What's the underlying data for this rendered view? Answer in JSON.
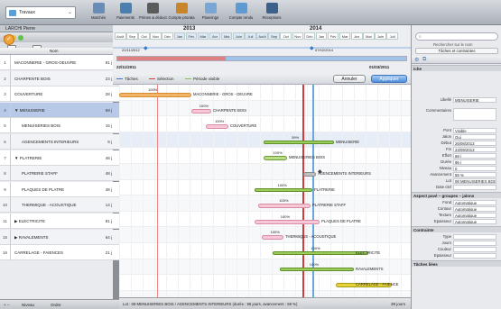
{
  "toolbar": {
    "project": "Travaux",
    "items": [
      {
        "label": "Marchés",
        "icon": "markets-icon",
        "color": "#6a8cb8"
      },
      {
        "label": "Paiements",
        "icon": "payments-icon",
        "color": "#4a7fb0"
      },
      {
        "label": "Primes & déduct.",
        "icon": "bonus-icon",
        "color": "#5b5b5b"
      },
      {
        "label": "Compte prorata",
        "icon": "prorata-icon",
        "color": "#c9852a"
      },
      {
        "label": "Plannings",
        "icon": "planning-icon",
        "color": "#7aa6d6"
      },
      {
        "label": "Compte rendu",
        "icon": "report-icon",
        "color": "#5e9bd5"
      },
      {
        "label": "Réceptions",
        "icon": "reception-icon",
        "color": "#3d5f8c"
      }
    ]
  },
  "user": "LARCHI Pierre",
  "left_tools": {
    "calendar": "Calendrier",
    "display": "Afficher"
  },
  "table": {
    "col_name": "Nom",
    "rows": [
      {
        "num": "1",
        "name": "MACONNERIE - GROS-OEUVRE",
        "dur": "91 j"
      },
      {
        "num": "2",
        "name": "CHARPENTE BOIS",
        "dur": "23 j"
      },
      {
        "num": "3",
        "name": "COUVERTURE",
        "dur": "28 j"
      },
      {
        "num": "4",
        "name": "▼ MENUISERIE",
        "dur": "69 j"
      },
      {
        "num": "5",
        "name": "MENUISERIES BOIS",
        "dur": "15 j"
      },
      {
        "num": "6",
        "name": "AGENCEMENTS INTERIEURS",
        "dur": "9 j"
      },
      {
        "num": "7",
        "name": "▼ PLATRERIE",
        "dur": "48 j"
      },
      {
        "num": "8",
        "name": "PLATRERIE STAFF",
        "dur": "48 j"
      },
      {
        "num": "9",
        "name": "PLAQUES DE PLATRE",
        "dur": "48 j"
      },
      {
        "num": "10",
        "name": "THERMIQUE - ACOUSTIQUE",
        "dur": "14 j"
      },
      {
        "num": "11",
        "name": "▶ ELECTRICITE",
        "dur": "81 j"
      },
      {
        "num": "15",
        "name": "▶ RAVALEMENTS",
        "dur": "64 j"
      },
      {
        "num": "16",
        "name": "CARRELAGE - FAIENCES",
        "dur": "21 j"
      }
    ]
  },
  "left_bottom": {
    "level": "Niveau",
    "order": "Ordre"
  },
  "timeline": {
    "year1": "2013",
    "year2": "2014",
    "months": [
      "Août",
      "Sep",
      "Oct",
      "Nov",
      "Déc",
      "Jan",
      "Fév",
      "Mar",
      "Avr",
      "Mai",
      "Juin",
      "Juil",
      "Août",
      "Sep",
      "Oct",
      "Nov",
      "Déc",
      "Jan",
      "Fév",
      "Mar",
      "Avr",
      "Mai",
      "Juin",
      "Juil"
    ],
    "date1": "22/11/2012",
    "date2": "07/02/2014",
    "range_start": "22/11/2011",
    "range_end": "01/03/2011"
  },
  "gantt_bar": {
    "legend_tasks": "Tâches",
    "legend_selection": "Sélection",
    "legend_visible": "Période visible",
    "cancel": "Annuler",
    "apply": "Appliquer"
  },
  "gantt_labels": [
    {
      "text": "MACONNERIE - GROS - OEUVRE",
      "pct": "100%"
    },
    {
      "text": "CHARPENTE BOIS",
      "pct": "100%"
    },
    {
      "text": "COUVERTURE",
      "pct": "100%"
    },
    {
      "text": "MENUISERIE",
      "pct": "59%"
    },
    {
      "text": "MENUISERIES BOIS",
      "pct": "100%"
    },
    {
      "text": "AGENCEMENTS INTERIEURS",
      "pct": ""
    },
    {
      "text": "PLATRERIE",
      "pct": "100%"
    },
    {
      "text": "PLATRERIE STAFF",
      "pct": "100%"
    },
    {
      "text": "PLAQUES DE PLATRE",
      "pct": "100%"
    },
    {
      "text": "THERMIQUE - ACOUSTIQUE",
      "pct": "100%"
    },
    {
      "text": "ELECTRICITE",
      "pct": "100%"
    },
    {
      "text": "RAVALEMENTS",
      "pct": "100%"
    },
    {
      "text": "CARRELAGE - FAIENCE",
      "pct": ""
    }
  ],
  "status": {
    "text": "Lot : 08 MENUISERIES BOIS / AGENCEMENTS INTERIEURS (durée : 96 jours, avancement : 59 %)",
    "right": "39 jours"
  },
  "inspector": {
    "search_label": "Rechercher sur le nom",
    "tasks_label": "Tâches et contraintes",
    "section_task": "iche",
    "libelle_k": "Libellé",
    "libelle_v": "MENUISERIE",
    "comments_k": "Commentaires",
    "pont_k": "Pont",
    "pont_v": "Visible",
    "jalon_k": "Jalon",
    "jalon_v": "Oui",
    "debut_k": "Début",
    "debut_v": "26/08/2013",
    "fin_k": "Fin",
    "fin_v": "23/09/2013",
    "effort_k": "Effort",
    "effort_v": "68 j",
    "duree_k": "Durée",
    "duree_v": "96 j",
    "niveau_k": "Niveau",
    "niveau_v": "0",
    "avancement_k": "Avancement",
    "avancement_v": "59 %",
    "lot_k": "Lot",
    "lot_v": "08 MENUISERIES BOIS / A",
    "datecf_k": "Date clef",
    "section_look": "Aspect pavé – groupes – jalons",
    "fond_k": "Fond",
    "fond_v": "Automatique",
    "contour_k": "Contour",
    "contour_v": "Automatique",
    "texture_k": "Texture",
    "texture_v": "Automatique",
    "epaisseur_k": "Epaisseur",
    "epaisseur_v": "Automatique",
    "section_constraint": "Contrainte",
    "type_k": "Type",
    "jours_k": "Jours",
    "couleur_k": "Couleur",
    "epaisseur2_k": "Epaisseur",
    "section_linked": "Tâches liées"
  }
}
